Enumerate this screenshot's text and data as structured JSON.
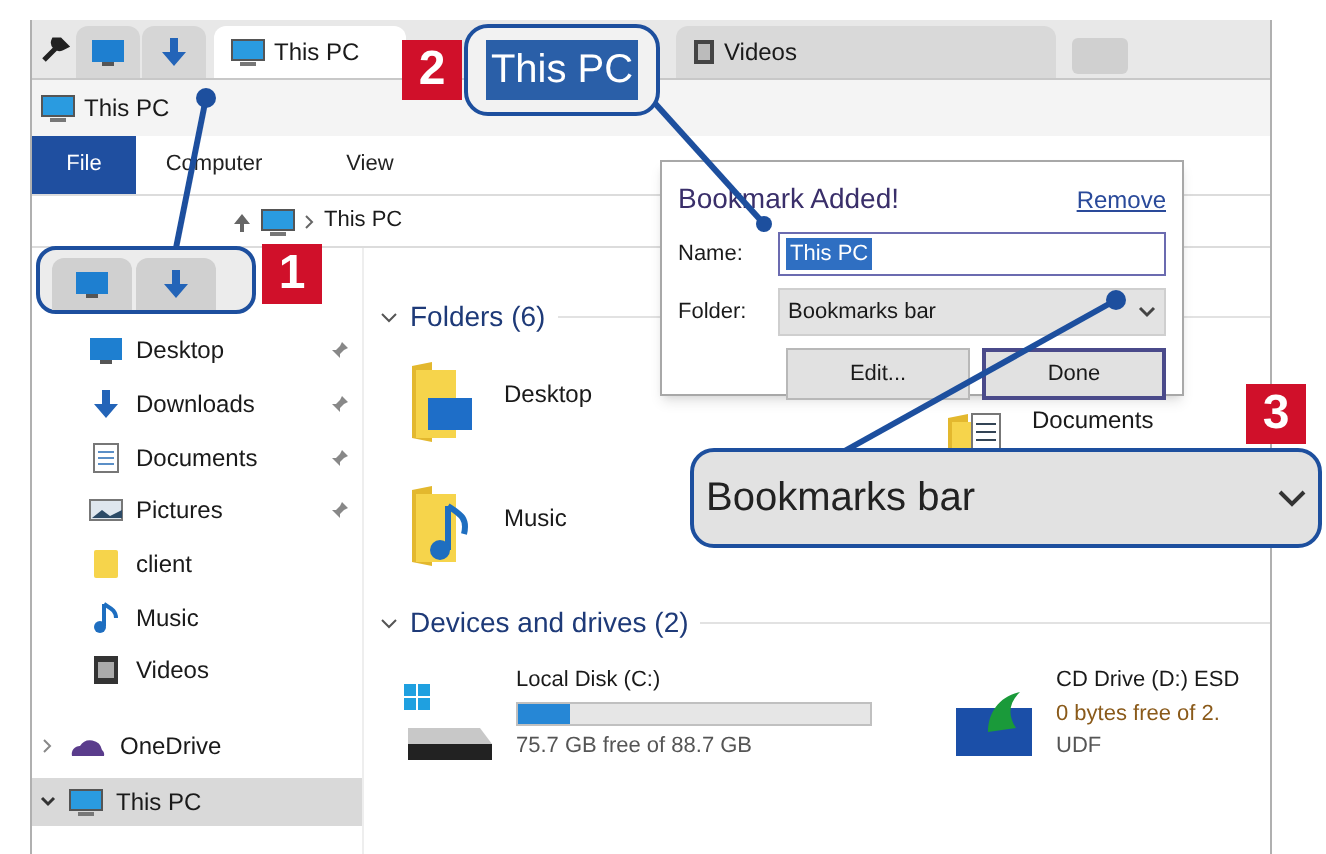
{
  "browser": {
    "tabs": [
      {
        "label": "This PC",
        "selected": true
      },
      {
        "label": "Videos",
        "selected": false
      }
    ]
  },
  "window": {
    "title": "This PC"
  },
  "ribbon": {
    "tabs": [
      {
        "label": "File",
        "selected": true
      },
      {
        "label": "Computer",
        "selected": false
      },
      {
        "label": "View",
        "selected": false
      }
    ]
  },
  "address": {
    "path": "This PC"
  },
  "sidebar": {
    "items": [
      {
        "label": "Desktop",
        "kind": "desktop",
        "pinned": true
      },
      {
        "label": "Downloads",
        "kind": "downloads",
        "pinned": true
      },
      {
        "label": "Documents",
        "kind": "documents",
        "pinned": true
      },
      {
        "label": "Pictures",
        "kind": "pictures",
        "pinned": true
      },
      {
        "label": "client",
        "kind": "folder",
        "pinned": false
      },
      {
        "label": "Music",
        "kind": "music",
        "pinned": false
      },
      {
        "label": "Videos",
        "kind": "videos",
        "pinned": false
      }
    ],
    "sections": [
      {
        "label": "OneDrive",
        "kind": "cloud",
        "expanded": false,
        "selected": false
      },
      {
        "label": "This PC",
        "kind": "pc",
        "expanded": true,
        "selected": true
      }
    ]
  },
  "folders": {
    "heading": "Folders (6)",
    "items": [
      {
        "label": "Desktop",
        "kind": "desktop"
      },
      {
        "label": "Music",
        "kind": "music"
      },
      {
        "label": "Documents",
        "kind": "documents"
      }
    ]
  },
  "drives": {
    "heading": "Devices and drives (2)",
    "items": [
      {
        "kind": "disk",
        "name": "Local Disk (C:)",
        "level": 0.15,
        "free": "75.7 GB free of 88.7 GB"
      },
      {
        "kind": "optical",
        "name": "CD Drive (D:) ESD",
        "free": "0 bytes free of 2.",
        "filesystem": "UDF"
      }
    ]
  },
  "bookmark_popup": {
    "title": "Bookmark Added!",
    "remove_link": "Remove",
    "name_label": "Name:",
    "name_value": "This PC",
    "folder_label": "Folder:",
    "folder_value": "Bookmarks bar",
    "buttons": [
      "Edit...",
      "Done"
    ]
  },
  "callouts": [
    {
      "number": "1"
    },
    {
      "number": "2",
      "text": "This PC"
    },
    {
      "number": "3",
      "text": "Bookmarks bar"
    }
  ]
}
